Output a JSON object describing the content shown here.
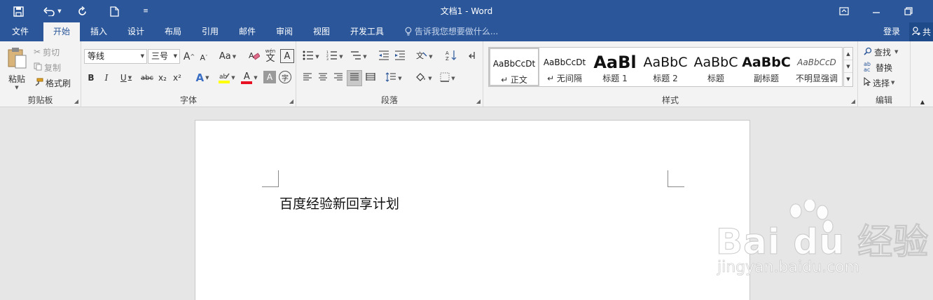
{
  "app": {
    "title": "文档1 - Word"
  },
  "quick_access": {
    "save_icon": "save-icon",
    "undo_icon": "undo-icon",
    "redo_icon": "redo-icon",
    "new_icon": "new-document-icon",
    "customize_icon": "customize-icon"
  },
  "menu": {
    "tabs": [
      {
        "label": "文件"
      },
      {
        "label": "开始"
      },
      {
        "label": "插入"
      },
      {
        "label": "设计"
      },
      {
        "label": "布局"
      },
      {
        "label": "引用"
      },
      {
        "label": "邮件"
      },
      {
        "label": "审阅"
      },
      {
        "label": "视图"
      },
      {
        "label": "开发工具"
      }
    ],
    "tell_me": "告诉我您想要做什么...",
    "login": "登录",
    "share": "共"
  },
  "clipboard": {
    "paste": "粘贴",
    "cut": "剪切",
    "copy": "复制",
    "format_painter": "格式刷",
    "group_label": "剪贴板"
  },
  "font": {
    "font_name": "等线",
    "font_size": "三号",
    "grow": "A",
    "shrink": "A",
    "change_case": "Aa",
    "phonetic_top": "wén",
    "phonetic_char": "文",
    "char_border": "A",
    "bold": "B",
    "italic": "I",
    "underline": "U",
    "strikethrough": "abc",
    "subscript": "x₂",
    "superscript": "x²",
    "text_effects": "A",
    "font_color": "A",
    "char_shading": "A",
    "enclose": "字",
    "group_label": "字体",
    "highlight_color": "#ffff00",
    "font_color_value": "#e81123"
  },
  "paragraph": {
    "group_label": "段落"
  },
  "styles": {
    "items": [
      {
        "sample": "AaBbCcDt",
        "name": "↵ 正文"
      },
      {
        "sample": "AaBbCcDt",
        "name": "↵ 无间隔"
      },
      {
        "sample": "AaBl",
        "name": "标题 1"
      },
      {
        "sample": "AaBbC",
        "name": "标题 2"
      },
      {
        "sample": "AaBbC",
        "name": "标题"
      },
      {
        "sample": "AaBbC",
        "name": "副标题"
      },
      {
        "sample": "AaBbCcD",
        "name": "不明显强调"
      }
    ],
    "group_label": "样式"
  },
  "editing": {
    "find": "查找",
    "replace": "替换",
    "select": "选择",
    "group_label": "编辑"
  },
  "document": {
    "text": "百度经验新回享计划"
  },
  "watermark": {
    "brand": "Bai du 经验",
    "url": "jingyan.baidu.com"
  },
  "colors": {
    "accent": "#2b579a",
    "ribbon": "#f3f3f3",
    "canvas": "#e6e6e6"
  }
}
